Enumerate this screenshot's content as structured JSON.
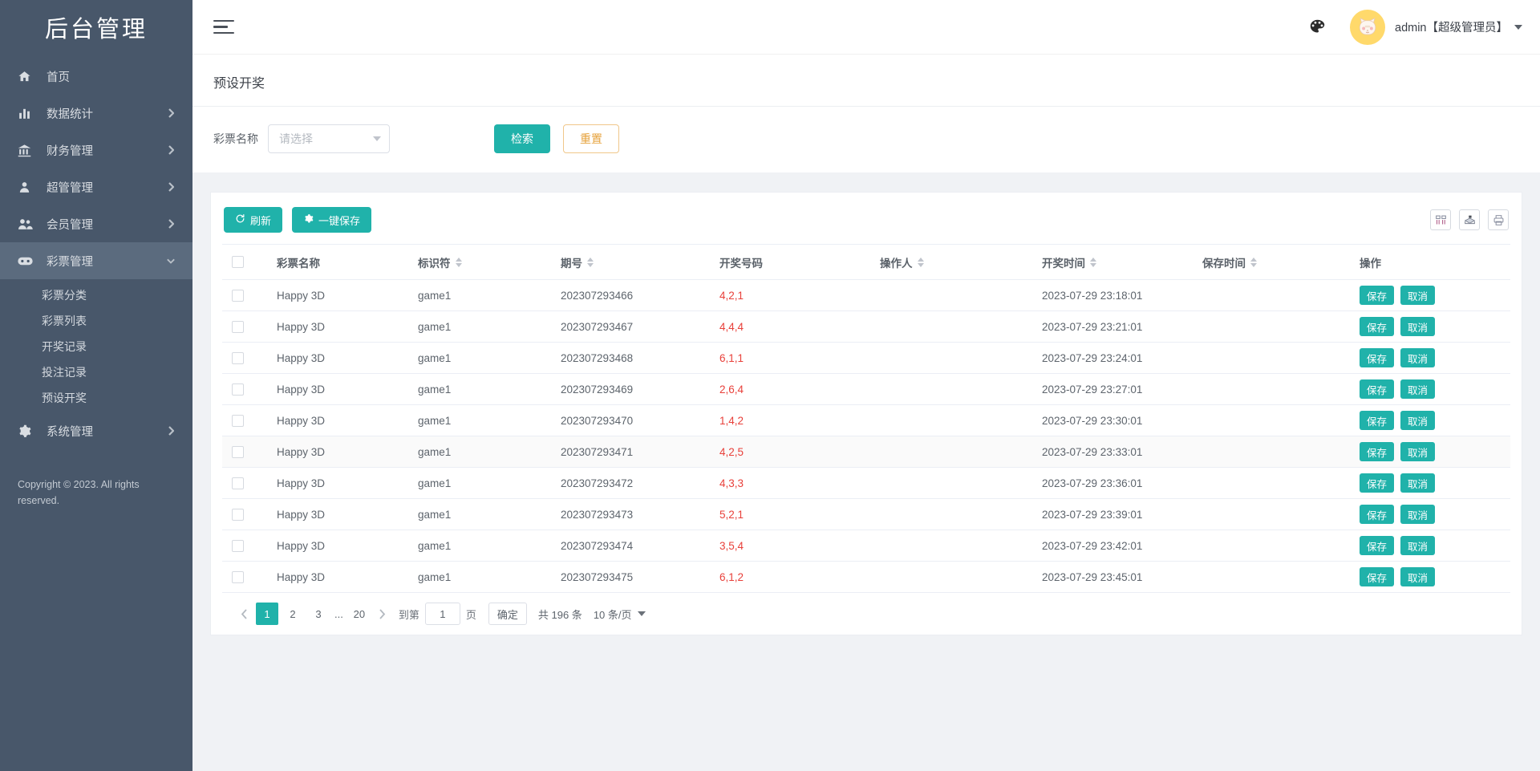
{
  "sidebar": {
    "brand": "后台管理",
    "items": [
      {
        "label": "首页",
        "icon": "home-icon",
        "has_arrow": false,
        "active": false
      },
      {
        "label": "数据统计",
        "icon": "chart-bar-icon",
        "has_arrow": true,
        "active": false
      },
      {
        "label": "财务管理",
        "icon": "bank-icon",
        "has_arrow": true,
        "active": false
      },
      {
        "label": "超管管理",
        "icon": "user-icon",
        "has_arrow": true,
        "active": false
      },
      {
        "label": "会员管理",
        "icon": "users-icon",
        "has_arrow": true,
        "active": false
      },
      {
        "label": "彩票管理",
        "icon": "gamepad-icon",
        "has_arrow": true,
        "active": true
      },
      {
        "label": "系统管理",
        "icon": "gear-icon",
        "has_arrow": true,
        "active": false
      }
    ],
    "submenu": [
      "彩票分类",
      "彩票列表",
      "开奖记录",
      "投注记录",
      "预设开奖"
    ],
    "copyright": "Copyright © 2023. All rights reserved."
  },
  "topbar": {
    "menu_toggle": "hamburger-icon",
    "theme_icon": "palette-icon",
    "avatar_icon": "cat-avatar",
    "user_name": "admin【超级管理员】"
  },
  "page": {
    "title": "预设开奖"
  },
  "filter": {
    "label": "彩票名称",
    "select_placeholder": "请选择",
    "search_label": "检索",
    "reset_label": "重置"
  },
  "toolbar": {
    "refresh_label": "刷新",
    "save_all_label": "一键保存",
    "columns_icon": "columns-icon",
    "export_icon": "export-icon",
    "print_icon": "print-icon"
  },
  "table": {
    "columns": [
      {
        "key": "checkbox",
        "label": "",
        "sortable": false
      },
      {
        "key": "name",
        "label": "彩票名称",
        "sortable": false
      },
      {
        "key": "flag",
        "label": "标识符",
        "sortable": true
      },
      {
        "key": "issue",
        "label": "期号",
        "sortable": true
      },
      {
        "key": "numbers",
        "label": "开奖号码",
        "sortable": false
      },
      {
        "key": "operator",
        "label": "操作人",
        "sortable": true
      },
      {
        "key": "draw_time",
        "label": "开奖时间",
        "sortable": true
      },
      {
        "key": "save_time",
        "label": "保存时间",
        "sortable": true
      },
      {
        "key": "action",
        "label": "操作",
        "sortable": false
      }
    ],
    "row_actions": {
      "save": "保存",
      "cancel": "取消"
    },
    "rows": [
      {
        "name": "Happy 3D",
        "flag": "game1",
        "issue": "202307293466",
        "numbers": "4,2,1",
        "operator": "",
        "draw_time": "2023-07-29 23:18:01",
        "save_time": ""
      },
      {
        "name": "Happy 3D",
        "flag": "game1",
        "issue": "202307293467",
        "numbers": "4,4,4",
        "operator": "",
        "draw_time": "2023-07-29 23:21:01",
        "save_time": ""
      },
      {
        "name": "Happy 3D",
        "flag": "game1",
        "issue": "202307293468",
        "numbers": "6,1,1",
        "operator": "",
        "draw_time": "2023-07-29 23:24:01",
        "save_time": ""
      },
      {
        "name": "Happy 3D",
        "flag": "game1",
        "issue": "202307293469",
        "numbers": "2,6,4",
        "operator": "",
        "draw_time": "2023-07-29 23:27:01",
        "save_time": ""
      },
      {
        "name": "Happy 3D",
        "flag": "game1",
        "issue": "202307293470",
        "numbers": "1,4,2",
        "operator": "",
        "draw_time": "2023-07-29 23:30:01",
        "save_time": ""
      },
      {
        "name": "Happy 3D",
        "flag": "game1",
        "issue": "202307293471",
        "numbers": "4,2,5",
        "operator": "",
        "draw_time": "2023-07-29 23:33:01",
        "save_time": ""
      },
      {
        "name": "Happy 3D",
        "flag": "game1",
        "issue": "202307293472",
        "numbers": "4,3,3",
        "operator": "",
        "draw_time": "2023-07-29 23:36:01",
        "save_time": ""
      },
      {
        "name": "Happy 3D",
        "flag": "game1",
        "issue": "202307293473",
        "numbers": "5,2,1",
        "operator": "",
        "draw_time": "2023-07-29 23:39:01",
        "save_time": ""
      },
      {
        "name": "Happy 3D",
        "flag": "game1",
        "issue": "202307293474",
        "numbers": "3,5,4",
        "operator": "",
        "draw_time": "2023-07-29 23:42:01",
        "save_time": ""
      },
      {
        "name": "Happy 3D",
        "flag": "game1",
        "issue": "202307293475",
        "numbers": "6,1,2",
        "operator": "",
        "draw_time": "2023-07-29 23:45:01",
        "save_time": ""
      }
    ]
  },
  "pagination": {
    "pages": [
      "1",
      "2",
      "3"
    ],
    "ellipsis": "...",
    "last_page": "20",
    "current_page": "1",
    "jump_prefix": "到第",
    "jump_value": "1",
    "jump_suffix": "页",
    "confirm_label": "确定",
    "total_text": "共 196 条",
    "page_size_text": "10 条/页"
  },
  "colors": {
    "sidebar_bg": "#48576a",
    "sidebar_active": "#5b6b7e",
    "primary": "#20b2aa",
    "warning": "#e6a23c",
    "number_red": "#e8403a",
    "avatar_bg": "#ffd96b"
  }
}
